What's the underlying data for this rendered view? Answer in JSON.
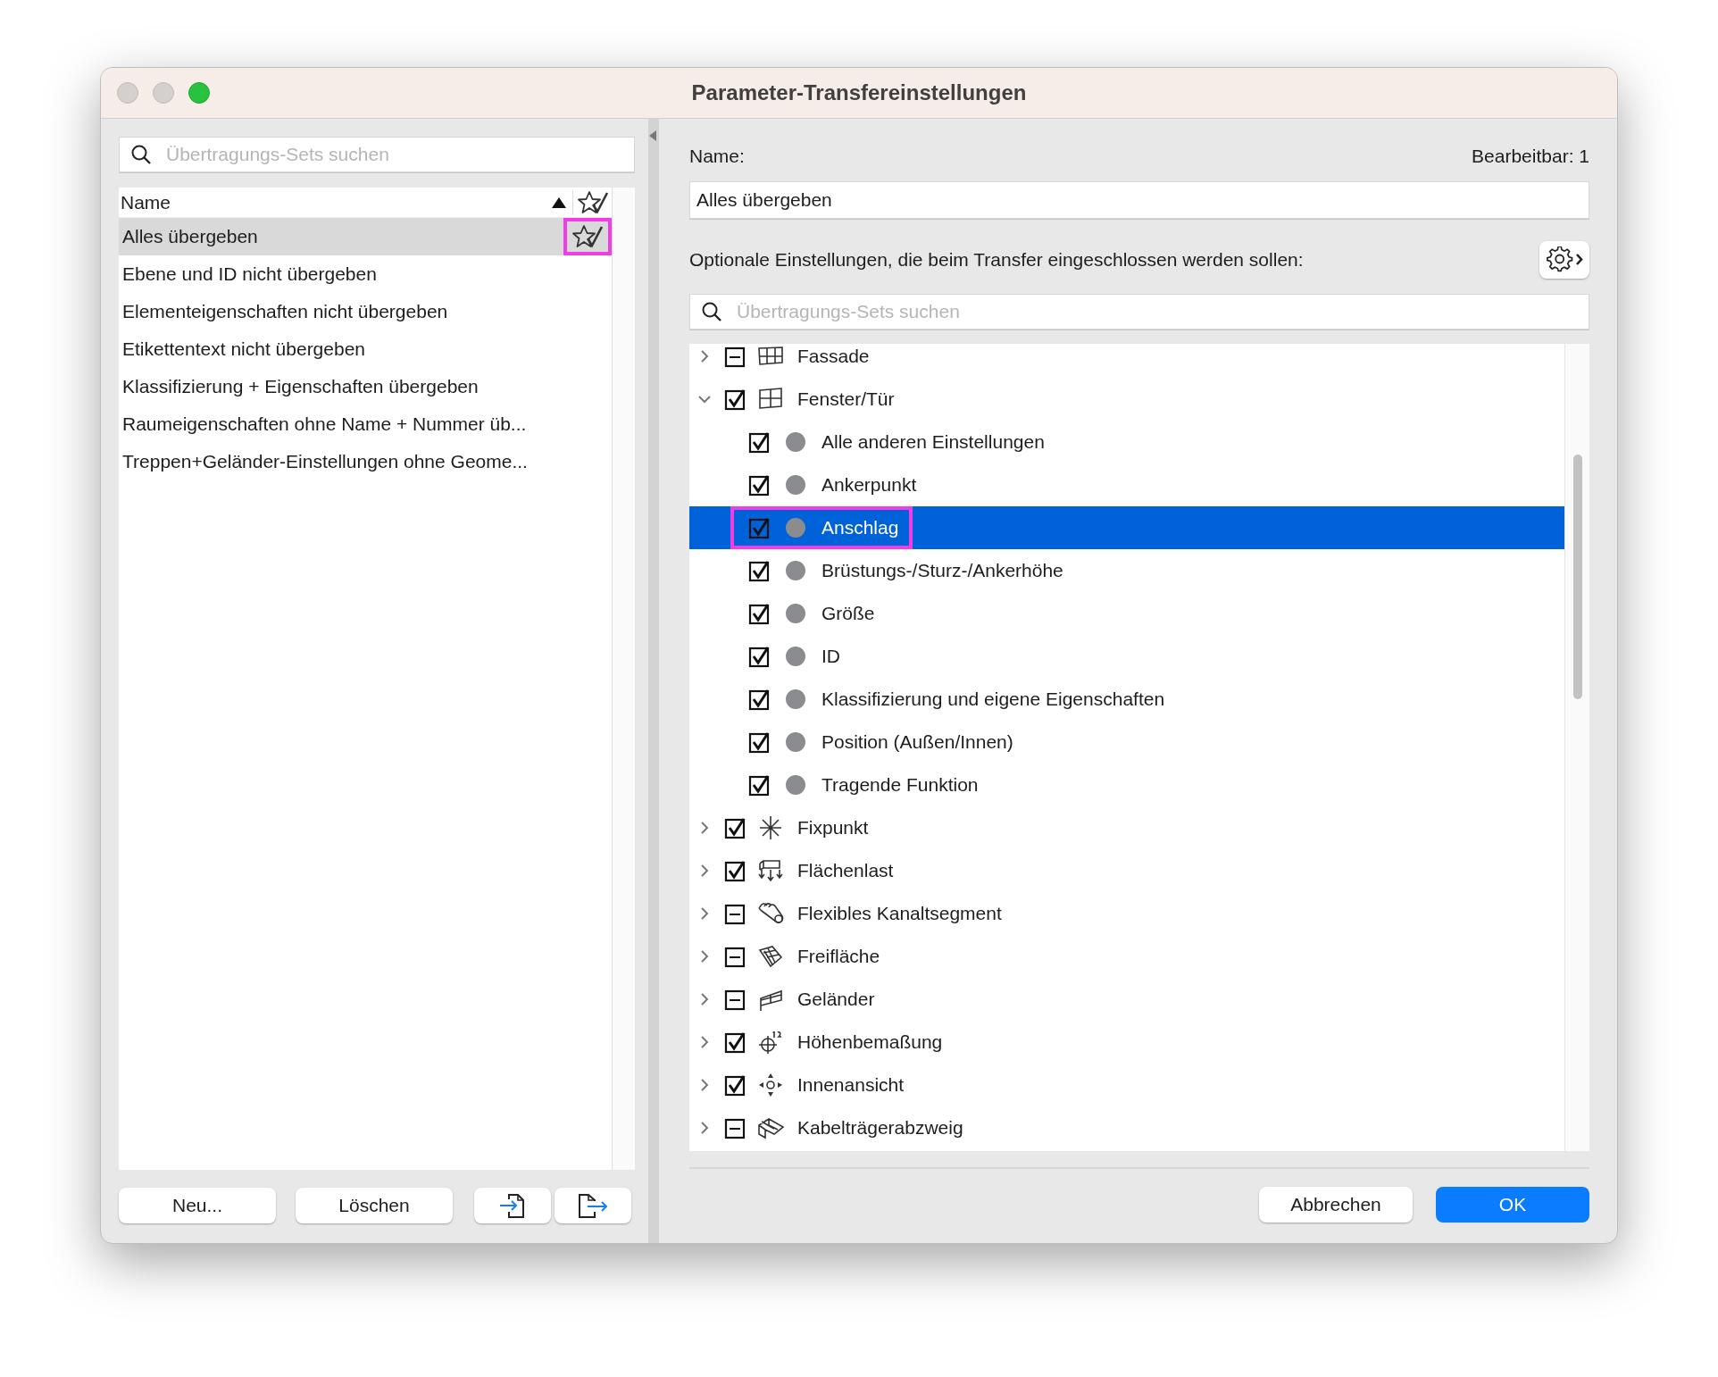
{
  "window": {
    "title": "Parameter-Transfereinstellungen"
  },
  "left": {
    "search": {
      "placeholder": "Übertragungs-Sets suchen"
    },
    "header": {
      "name": "Name"
    },
    "items": [
      {
        "label": "Alles übergeben",
        "selected": true,
        "default": true,
        "highlighted": true
      },
      {
        "label": "Ebene und ID nicht übergeben",
        "selected": false,
        "default": false,
        "highlighted": false
      },
      {
        "label": "Elementeigenschaften nicht übergeben",
        "selected": false,
        "default": false,
        "highlighted": false
      },
      {
        "label": "Etikettentext nicht übergeben",
        "selected": false,
        "default": false,
        "highlighted": false
      },
      {
        "label": "Klassifizierung + Eigenschaften übergeben",
        "selected": false,
        "default": false,
        "highlighted": false
      },
      {
        "label": "Raumeigenschaften ohne Name + Nummer üb...",
        "selected": false,
        "default": false,
        "highlighted": false
      },
      {
        "label": "Treppen+Geländer-Einstellungen ohne Geome...",
        "selected": false,
        "default": false,
        "highlighted": false
      }
    ],
    "buttons": [
      "Neu...",
      "Löschen"
    ]
  },
  "right": {
    "name_label": "Name:",
    "editable": "Bearbeitbar: 1",
    "name_value": "Alles übergeben",
    "options_label": "Optionale Einstellungen, die beim Transfer eingeschlossen werden sollen:",
    "search": {
      "placeholder": "Übertragungs-Sets suchen"
    },
    "tree": [
      {
        "label": "Fassade",
        "checked": false,
        "expanded": false,
        "selected": false
      },
      {
        "label": "Fenster/Tür",
        "checked": true,
        "expanded": true,
        "selected": false,
        "children": [
          {
            "label": "Alle anderen Einstellungen",
            "checked": true,
            "selected": false,
            "highlighted": false
          },
          {
            "label": "Ankerpunkt",
            "checked": true,
            "selected": false,
            "highlighted": false
          },
          {
            "label": "Anschlag",
            "checked": true,
            "selected": true,
            "highlighted": true
          },
          {
            "label": "Brüstungs-/Sturz-/Ankerhöhe",
            "checked": true,
            "selected": false,
            "highlighted": false
          },
          {
            "label": "Größe",
            "checked": true,
            "selected": false,
            "highlighted": false
          },
          {
            "label": "ID",
            "checked": true,
            "selected": false,
            "highlighted": false
          },
          {
            "label": "Klassifizierung und eigene Eigenschaften",
            "checked": true,
            "selected": false,
            "highlighted": false
          },
          {
            "label": "Position (Außen/Innen)",
            "checked": true,
            "selected": false,
            "highlighted": false
          },
          {
            "label": "Tragende Funktion",
            "checked": true,
            "selected": false,
            "highlighted": false
          }
        ]
      },
      {
        "label": "Fixpunkt",
        "checked": true,
        "expanded": false,
        "selected": false
      },
      {
        "label": "Flächenlast",
        "checked": true,
        "expanded": false,
        "selected": false
      },
      {
        "label": "Flexibles Kanaltsegment",
        "checked": false,
        "expanded": false,
        "selected": false
      },
      {
        "label": "Freifläche",
        "checked": false,
        "expanded": false,
        "selected": false
      },
      {
        "label": "Geländer",
        "checked": false,
        "expanded": false,
        "selected": false
      },
      {
        "label": "Höhenbemaßung",
        "checked": true,
        "expanded": false,
        "selected": false
      },
      {
        "label": "Innenansicht",
        "checked": true,
        "expanded": false,
        "selected": false
      },
      {
        "label": "Kabelträgerabzweig",
        "checked": false,
        "expanded": false,
        "selected": false
      }
    ],
    "buttons": {
      "cancel": "Abbrechen",
      "ok": "OK"
    }
  }
}
